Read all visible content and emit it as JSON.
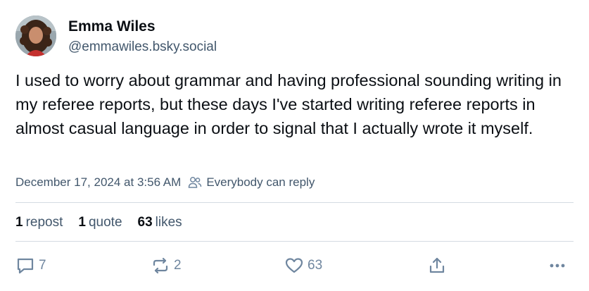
{
  "author": {
    "name": "Emma Wiles",
    "handle": "@emmawiles.bsky.social"
  },
  "post": {
    "text": "I used to worry about grammar and having professional sounding writing in my referee reports, but these days I've started writing referee reports in almost casual language in order to signal that I actually wrote it myself.",
    "timestamp": "December 17, 2024 at 3:56 AM",
    "reply_setting": "Everybody can reply"
  },
  "stats": {
    "reposts": "1",
    "reposts_label": "repost",
    "quotes": "1",
    "quotes_label": "quote",
    "likes": "63",
    "likes_label": "likes"
  },
  "actions": {
    "reply_count": "7",
    "repost_count": "2",
    "like_count": "63",
    "reply_icon": "comment-icon",
    "repost_icon": "repost-icon",
    "like_icon": "heart-icon",
    "share_icon": "share-icon",
    "more_icon": "ellipsis-icon"
  },
  "colors": {
    "text": "#0b0f14",
    "muted": "#42576c",
    "icon": "#6f869f",
    "divider": "#d4dbe2"
  }
}
